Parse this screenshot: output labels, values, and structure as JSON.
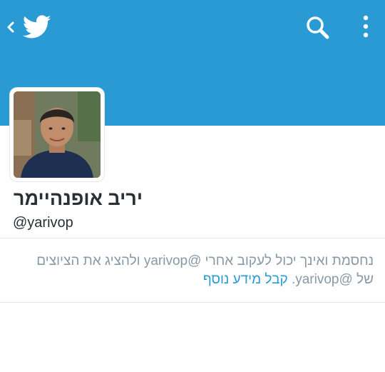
{
  "header": {
    "background": "#2a9ad4",
    "back_icon": "chevron-left-icon",
    "logo_icon": "twitter-bird-icon",
    "search_icon": "search-icon",
    "more_icon": "more-vertical-icon"
  },
  "profile": {
    "name": "יריב אופנהיימר",
    "handle": "@yarivop"
  },
  "notice": {
    "text": "נחסמת ואינך יכול לעקוב אחרי @yarivop ולהציג את הציוצים של @yarivop.",
    "link_label": "קבל מידע נוסף",
    "link_color": "#2a9ad4"
  }
}
